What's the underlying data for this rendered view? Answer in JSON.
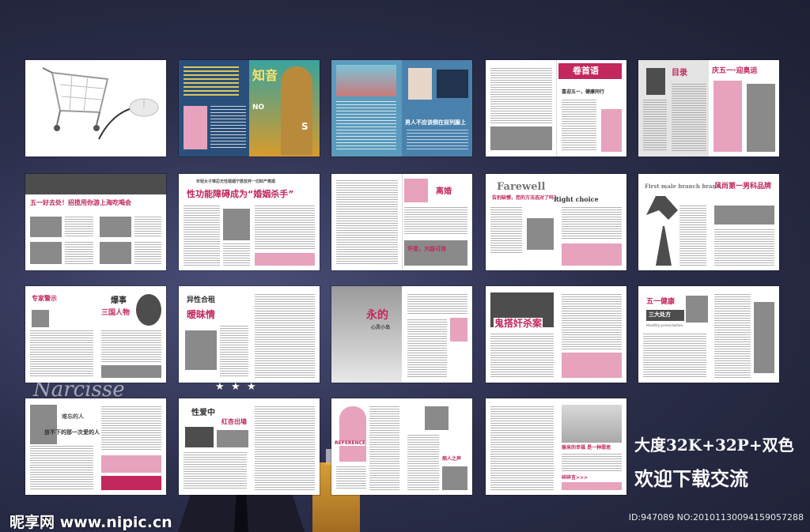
{
  "background": {
    "watermark_script": "Narcisse",
    "colors": {
      "accent": "#c2275e",
      "background": "#2c2f4c"
    }
  },
  "thumbnails": {
    "t01": {
      "icon": "shopping-cart-icon",
      "icon2": "computer-mouse-icon"
    },
    "t02": {
      "head": "知音",
      "sub": "NO",
      "side": "S"
    },
    "t03": {
      "head": "男人不应该倒在前列腺上"
    },
    "t04": {
      "tab": "卷首语",
      "head": "喜迎五一，健康同行"
    },
    "t05": {
      "tab": "目录",
      "head": "庆五一·迎奥运"
    },
    "t06": {
      "head": "五一好去处！招揽用你游上海吃喝会"
    },
    "t07": {
      "kicker": "年轻女子难忍无性婚姻宁愿放弃一切财产离婚",
      "head": "性功能障碍成为“婚姻杀手”"
    },
    "t08": {
      "head": "离婚",
      "sub": "坏蛋，大路可退"
    },
    "t09": {
      "head": "Farewell",
      "sub": "Right choice",
      "line": "告别缺憾，您的方法选对了吗？"
    },
    "t10": {
      "head": "First male branch brand",
      "sub": "风尚第一男科品牌"
    },
    "t11": {
      "head": "专家警示",
      "sub": "三国人物",
      "side": "爆事"
    },
    "t12": {
      "head": "异性合租",
      "sub": "暧昧情"
    },
    "t13": {
      "head": "永的",
      "sub": "心灵小岛"
    },
    "t14": {
      "head": "鬼搭奸杀案"
    },
    "t15": {
      "head": "五一健康",
      "sub": "三大处方",
      "en": "Healthy prescription"
    },
    "t16": {
      "head": "难忘的人",
      "sub": "放不下的那一次爱的人"
    },
    "t17": {
      "head": "性爱中",
      "sub": "红杏出墙"
    },
    "t18": {
      "head": "REFERENCE",
      "sub": "病人之声"
    },
    "t19": {
      "head": "偷来的幸福 是一种罪恶",
      "sub": "碎碎言>>>"
    }
  },
  "caption": {
    "line1": "大度32K+32P+双色",
    "line2": "欢迎下载交流"
  },
  "footer": {
    "logo": "昵享网 www.nipic.cn",
    "id": "ID:947089 NO:20101130094159057288"
  }
}
